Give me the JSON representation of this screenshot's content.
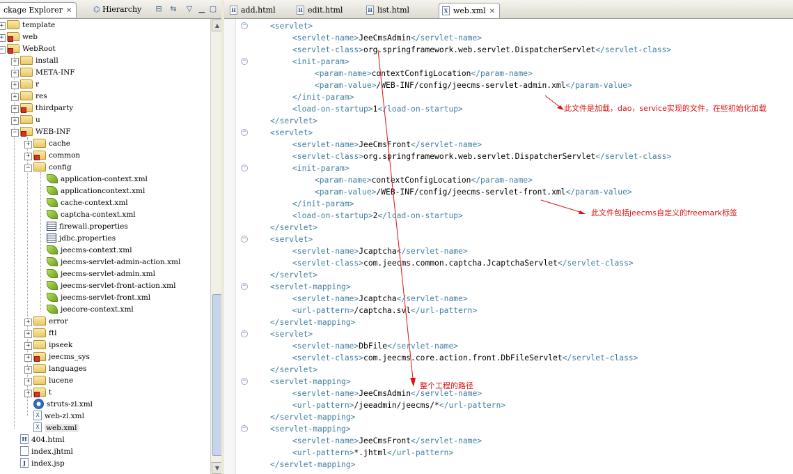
{
  "left_panel": {
    "tabs": [
      {
        "label": "ckage Explorer",
        "active": true
      },
      {
        "label": "Hierarchy",
        "active": false
      }
    ],
    "tree": [
      {
        "label": "template",
        "icon": "folder-icon",
        "depth": 0,
        "expand": "+"
      },
      {
        "label": "web",
        "icon": "folder-red-icon",
        "depth": 0,
        "expand": "+"
      },
      {
        "label": "WebRoot",
        "icon": "folder-red-icon",
        "depth": 0,
        "expand": "-"
      },
      {
        "label": "install",
        "icon": "folder-icon",
        "depth": 1,
        "expand": "+"
      },
      {
        "label": "META-INF",
        "icon": "folder-icon",
        "depth": 1,
        "expand": "+"
      },
      {
        "label": "r",
        "icon": "folder-icon",
        "depth": 1,
        "expand": "+"
      },
      {
        "label": "res",
        "icon": "folder-icon",
        "depth": 1,
        "expand": "+"
      },
      {
        "label": "thirdparty",
        "icon": "folder-red-icon",
        "depth": 1,
        "expand": "+"
      },
      {
        "label": "u",
        "icon": "folder-icon",
        "depth": 1,
        "expand": "+"
      },
      {
        "label": "WEB-INF",
        "icon": "folder-red-icon",
        "depth": 1,
        "expand": "-"
      },
      {
        "label": "cache",
        "icon": "folder-icon",
        "depth": 2,
        "expand": "+"
      },
      {
        "label": "common",
        "icon": "folder-red-icon",
        "depth": 2,
        "expand": "+"
      },
      {
        "label": "config",
        "icon": "folder-icon",
        "depth": 2,
        "expand": "-"
      },
      {
        "label": "application-context.xml",
        "icon": "spring-leaf-icon",
        "depth": 3,
        "expand": ""
      },
      {
        "label": "applicationcontext.xml",
        "icon": "spring-leaf-icon",
        "depth": 3,
        "expand": ""
      },
      {
        "label": "cache-context.xml",
        "icon": "spring-leaf-icon",
        "depth": 3,
        "expand": ""
      },
      {
        "label": "captcha-context.xml",
        "icon": "spring-leaf-icon",
        "depth": 3,
        "expand": ""
      },
      {
        "label": "firewall.properties",
        "icon": "properties-file-icon",
        "depth": 3,
        "expand": ""
      },
      {
        "label": "jdbc.properties",
        "icon": "properties-file-icon",
        "depth": 3,
        "expand": ""
      },
      {
        "label": "jeecms-context.xml",
        "icon": "spring-leaf-icon",
        "depth": 3,
        "expand": ""
      },
      {
        "label": "jeecms-servlet-admin-action.xml",
        "icon": "spring-leaf-icon",
        "depth": 3,
        "expand": ""
      },
      {
        "label": "jeecms-servlet-admin.xml",
        "icon": "spring-leaf-icon",
        "depth": 3,
        "expand": ""
      },
      {
        "label": "jeecms-servlet-front-action.xml",
        "icon": "spring-leaf-icon",
        "depth": 3,
        "expand": ""
      },
      {
        "label": "jeecms-servlet-front.xml",
        "icon": "spring-leaf-icon",
        "depth": 3,
        "expand": ""
      },
      {
        "label": "jeecore-context.xml",
        "icon": "spring-leaf-icon",
        "depth": 3,
        "expand": ""
      },
      {
        "label": "error",
        "icon": "folder-icon",
        "depth": 2,
        "expand": "+"
      },
      {
        "label": "ftl",
        "icon": "folder-icon",
        "depth": 2,
        "expand": "+"
      },
      {
        "label": "ipseek",
        "icon": "folder-icon",
        "depth": 2,
        "expand": "+"
      },
      {
        "label": "jeecms_sys",
        "icon": "folder-red-icon",
        "depth": 2,
        "expand": "+"
      },
      {
        "label": "languages",
        "icon": "folder-icon",
        "depth": 2,
        "expand": "+"
      },
      {
        "label": "lucene",
        "icon": "folder-icon",
        "depth": 2,
        "expand": "+"
      },
      {
        "label": "t",
        "icon": "folder-red-icon",
        "depth": 2,
        "expand": "+"
      },
      {
        "label": "struts-zl.xml",
        "icon": "struts-gear-icon",
        "depth": 2,
        "expand": ""
      },
      {
        "label": "web-zl.xml",
        "icon": "xml-file-icon",
        "depth": 2,
        "expand": ""
      },
      {
        "label": "web.xml",
        "icon": "xml-file-icon",
        "depth": 2,
        "expand": "",
        "selected": true
      },
      {
        "label": "404.html",
        "icon": "html-file-icon",
        "depth": 1,
        "expand": ""
      },
      {
        "label": "index.jhtml",
        "icon": "file-icon",
        "depth": 1,
        "expand": ""
      },
      {
        "label": "index.jsp",
        "icon": "jsp-file-icon",
        "depth": 1,
        "expand": ""
      }
    ]
  },
  "editor": {
    "tabs": [
      {
        "label": "add.html",
        "type": "H",
        "active": false
      },
      {
        "label": "edit.html",
        "type": "H",
        "active": false
      },
      {
        "label": "list.html",
        "type": "H",
        "active": false
      },
      {
        "label": "web.xml",
        "type": "X",
        "active": true
      }
    ],
    "lines": [
      {
        "indent": 0,
        "fold": true,
        "parts": [
          [
            "t",
            "<servlet>"
          ]
        ]
      },
      {
        "indent": 1,
        "fold": false,
        "parts": [
          [
            "t",
            "<servlet-name>"
          ],
          [
            "x",
            "JeeCmsAdmin"
          ],
          [
            "t",
            "</servlet-name>"
          ]
        ]
      },
      {
        "indent": 1,
        "fold": false,
        "parts": [
          [
            "t",
            "<servlet-class>"
          ],
          [
            "x",
            "org.springframework.web.servlet.DispatcherServlet"
          ],
          [
            "t",
            "</servlet-class>"
          ]
        ]
      },
      {
        "indent": 1,
        "fold": true,
        "parts": [
          [
            "t",
            "<init-param>"
          ]
        ]
      },
      {
        "indent": 2,
        "fold": false,
        "parts": [
          [
            "t",
            "<param-name>"
          ],
          [
            "x",
            "contextConfigLocation"
          ],
          [
            "t",
            "</param-name>"
          ]
        ]
      },
      {
        "indent": 2,
        "fold": false,
        "parts": [
          [
            "t",
            "<param-value>"
          ],
          [
            "x",
            "/WEB-INF/config/jeecms-servlet-admin.xml"
          ],
          [
            "t",
            "</param-value>"
          ]
        ]
      },
      {
        "indent": 1,
        "fold": false,
        "parts": [
          [
            "t",
            "</init-param>"
          ]
        ]
      },
      {
        "indent": 1,
        "fold": false,
        "parts": [
          [
            "t",
            "<load-on-startup>"
          ],
          [
            "x",
            "1"
          ],
          [
            "t",
            "</load-on-startup>"
          ]
        ]
      },
      {
        "indent": 0,
        "fold": false,
        "parts": [
          [
            "t",
            "</servlet>"
          ]
        ]
      },
      {
        "indent": 0,
        "fold": true,
        "parts": [
          [
            "t",
            "<servlet>"
          ]
        ]
      },
      {
        "indent": 1,
        "fold": false,
        "parts": [
          [
            "t",
            "<servlet-name>"
          ],
          [
            "x",
            "JeeCmsFront"
          ],
          [
            "t",
            "</servlet-name>"
          ]
        ]
      },
      {
        "indent": 1,
        "fold": false,
        "parts": [
          [
            "t",
            "<servlet-class>"
          ],
          [
            "x",
            "org.springframework.web.servlet.DispatcherServlet"
          ],
          [
            "t",
            "</servlet-class>"
          ]
        ]
      },
      {
        "indent": 1,
        "fold": true,
        "parts": [
          [
            "t",
            "<init-param>"
          ]
        ]
      },
      {
        "indent": 2,
        "fold": false,
        "parts": [
          [
            "t",
            "<param-name>"
          ],
          [
            "x",
            "contextConfigLocation"
          ],
          [
            "t",
            "</param-name>"
          ]
        ]
      },
      {
        "indent": 2,
        "fold": false,
        "parts": [
          [
            "t",
            "<param-value>"
          ],
          [
            "x",
            "/WEB-INF/config/jeecms-servlet-front.xml"
          ],
          [
            "t",
            "</param-value>"
          ]
        ]
      },
      {
        "indent": 1,
        "fold": false,
        "parts": [
          [
            "t",
            "</init-param>"
          ]
        ]
      },
      {
        "indent": 1,
        "fold": false,
        "parts": [
          [
            "t",
            "<load-on-startup>"
          ],
          [
            "x",
            "2"
          ],
          [
            "t",
            "</load-on-startup>"
          ]
        ]
      },
      {
        "indent": 0,
        "fold": false,
        "parts": [
          [
            "t",
            "</servlet>"
          ]
        ]
      },
      {
        "indent": 0,
        "fold": true,
        "parts": [
          [
            "t",
            "<servlet>"
          ]
        ]
      },
      {
        "indent": 1,
        "fold": false,
        "parts": [
          [
            "t",
            "<servlet-name>"
          ],
          [
            "x",
            "Jcaptcha"
          ],
          [
            "t",
            "</servlet-name>"
          ]
        ]
      },
      {
        "indent": 1,
        "fold": false,
        "parts": [
          [
            "t",
            "<servlet-class>"
          ],
          [
            "x",
            "com.jeecms.common.captcha.JcaptchaServlet"
          ],
          [
            "t",
            "</servlet-class>"
          ]
        ]
      },
      {
        "indent": 0,
        "fold": false,
        "parts": [
          [
            "t",
            "</servlet>"
          ]
        ]
      },
      {
        "indent": 0,
        "fold": true,
        "parts": [
          [
            "t",
            "<servlet-mapping>"
          ]
        ]
      },
      {
        "indent": 1,
        "fold": false,
        "parts": [
          [
            "t",
            "<servlet-name>"
          ],
          [
            "x",
            "Jcaptcha"
          ],
          [
            "t",
            "</servlet-name>"
          ]
        ]
      },
      {
        "indent": 1,
        "fold": false,
        "parts": [
          [
            "t",
            "<url-pattern>"
          ],
          [
            "x",
            "/captcha.svl"
          ],
          [
            "t",
            "</url-pattern>"
          ]
        ]
      },
      {
        "indent": 0,
        "fold": false,
        "parts": [
          [
            "t",
            "</servlet-mapping>"
          ]
        ]
      },
      {
        "indent": 0,
        "fold": true,
        "parts": [
          [
            "t",
            "<servlet>"
          ]
        ]
      },
      {
        "indent": 1,
        "fold": false,
        "parts": [
          [
            "t",
            "<servlet-name>"
          ],
          [
            "x",
            "DbFile"
          ],
          [
            "t",
            "</servlet-name>"
          ]
        ]
      },
      {
        "indent": 1,
        "fold": false,
        "parts": [
          [
            "t",
            "<servlet-class>"
          ],
          [
            "x",
            "com.jeecms.core.action.front.DbFileServlet"
          ],
          [
            "t",
            "</servlet-class>"
          ]
        ]
      },
      {
        "indent": 0,
        "fold": false,
        "parts": [
          [
            "t",
            "</servlet>"
          ]
        ]
      },
      {
        "indent": 0,
        "fold": true,
        "parts": [
          [
            "t",
            "<servlet-mapping>"
          ]
        ]
      },
      {
        "indent": 1,
        "fold": false,
        "parts": [
          [
            "t",
            "<servlet-name>"
          ],
          [
            "x",
            "JeeCmsAdmin"
          ],
          [
            "t",
            "</servlet-name>"
          ]
        ]
      },
      {
        "indent": 1,
        "fold": false,
        "parts": [
          [
            "t",
            "<url-pattern>"
          ],
          [
            "x",
            "/jeeadmin/jeecms/*"
          ],
          [
            "t",
            "</url-pattern>"
          ]
        ]
      },
      {
        "indent": 0,
        "fold": false,
        "parts": [
          [
            "t",
            "</servlet-mapping>"
          ]
        ]
      },
      {
        "indent": 0,
        "fold": true,
        "parts": [
          [
            "t",
            "<servlet-mapping>"
          ]
        ]
      },
      {
        "indent": 1,
        "fold": false,
        "parts": [
          [
            "t",
            "<servlet-name>"
          ],
          [
            "x",
            "JeeCmsFront"
          ],
          [
            "t",
            "</servlet-name>"
          ]
        ]
      },
      {
        "indent": 1,
        "fold": false,
        "parts": [
          [
            "t",
            "<url-pattern>"
          ],
          [
            "x",
            "*.jhtml"
          ],
          [
            "t",
            "</url-pattern>"
          ]
        ]
      },
      {
        "indent": 0,
        "fold": false,
        "parts": [
          [
            "t",
            "</servlet-mapping>"
          ]
        ]
      }
    ],
    "annotations": [
      {
        "text": "此文件是加载，dao，service实现的文件，在些初始化加载"
      },
      {
        "text": "此文件包括jeecms自定义的freemark标签"
      },
      {
        "text": "整个工程的路径"
      }
    ]
  },
  "colors": {
    "tag": "#3f7f9f",
    "text": "#000000",
    "annotation": "#dd1111",
    "arrow": "#dd1111"
  }
}
